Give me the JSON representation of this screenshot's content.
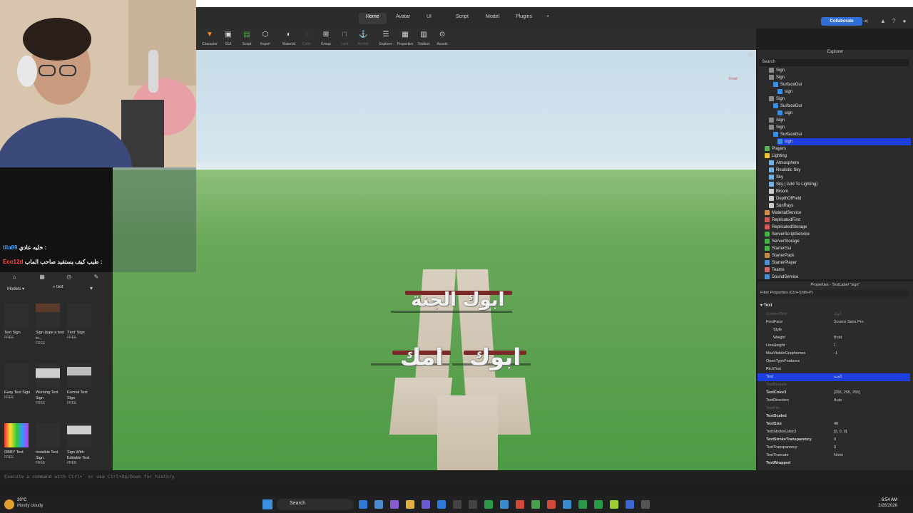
{
  "menubar": {
    "tabs": [
      "Home",
      "Avatar",
      "UI",
      "Script",
      "Model",
      "Plugins",
      "+"
    ],
    "active_tab": "Home",
    "collaborate_label": "Collaborate"
  },
  "toolbar": {
    "tools": [
      {
        "label": "Character",
        "icon": "character-icon"
      },
      {
        "label": "GUI",
        "icon": "gui-icon"
      },
      {
        "label": "Script",
        "icon": "script-icon"
      },
      {
        "label": "Import",
        "icon": "import-icon"
      },
      {
        "label": "Material",
        "icon": "material-icon"
      },
      {
        "label": "Color",
        "icon": "color-icon"
      },
      {
        "label": "Group",
        "icon": "group-icon"
      },
      {
        "label": "Lock",
        "icon": "lock-icon"
      },
      {
        "label": "Anchor",
        "icon": "anchor-icon"
      },
      {
        "label": "Explorer",
        "icon": "explorer-icon"
      },
      {
        "label": "Properties",
        "icon": "properties-icon"
      },
      {
        "label": "Toolbox",
        "icon": "toolbox-icon"
      },
      {
        "label": "Assets",
        "icon": "assets-icon"
      }
    ]
  },
  "viewport": {
    "viewcube_label": "Front",
    "signs": [
      "الجنة",
      "ابوك",
      "امك",
      "ابوك"
    ]
  },
  "chat": {
    "messages": [
      {
        "user": "tila89",
        "text": "خليه عادي :"
      },
      {
        "user": "Eco12d",
        "text": "طيب كيف يستفيد صاحب الماب :"
      }
    ]
  },
  "toolbox": {
    "category": "Models",
    "search_value": "text",
    "assets": [
      {
        "name": "Text Sign",
        "price": "FREE"
      },
      {
        "name": "Sign (type a text in...",
        "price": "FREE"
      },
      {
        "name": "'Text' Sign",
        "price": "FREE"
      },
      {
        "name": "Easy Text Sign",
        "price": "FREE"
      },
      {
        "name": "Working Text Sign",
        "price": "FREE"
      },
      {
        "name": "Formal Text Sign",
        "price": "FREE"
      },
      {
        "name": "OBBY Text",
        "price": "FREE"
      },
      {
        "name": "Invisible Text Sign",
        "price": "FREE"
      },
      {
        "name": "Sign With Editable Text",
        "price": "FREE"
      }
    ]
  },
  "explorer": {
    "title": "Explorer",
    "search_placeholder": "Search",
    "items": [
      {
        "label": "Sign",
        "indent": 1,
        "color": "#8a8a8a"
      },
      {
        "label": "Sign",
        "indent": 1,
        "color": "#8a8a8a"
      },
      {
        "label": "SurfaceGui",
        "indent": 2,
        "color": "#3a8fe0"
      },
      {
        "label": "sign",
        "indent": 3,
        "color": "#3a8fe0"
      },
      {
        "label": "Sign",
        "indent": 1,
        "color": "#8a8a8a"
      },
      {
        "label": "SurfaceGui",
        "indent": 2,
        "color": "#3a8fe0"
      },
      {
        "label": "sign",
        "indent": 3,
        "color": "#3a8fe0"
      },
      {
        "label": "Sign",
        "indent": 1,
        "color": "#8a8a8a"
      },
      {
        "label": "Sign",
        "indent": 1,
        "color": "#8a8a8a"
      },
      {
        "label": "SurfaceGui",
        "indent": 2,
        "color": "#3a8fe0"
      },
      {
        "label": "sign",
        "indent": 3,
        "color": "#3a8fe0",
        "selected": true
      },
      {
        "label": "Players",
        "indent": 0,
        "color": "#5ab55a"
      },
      {
        "label": "Lighting",
        "indent": 0,
        "color": "#e8c33a"
      },
      {
        "label": "Atmosphere",
        "indent": 1,
        "color": "#7ab0e0"
      },
      {
        "label": "Realistic Sky",
        "indent": 1,
        "color": "#7ab0e0"
      },
      {
        "label": "Sky",
        "indent": 1,
        "color": "#7ab0e0"
      },
      {
        "label": "Sky ( Add To Lighting)",
        "indent": 1,
        "color": "#7ab0e0"
      },
      {
        "label": "Bloom",
        "indent": 1,
        "color": "#c9c9c9"
      },
      {
        "label": "DepthOfField",
        "indent": 1,
        "color": "#c9c9c9"
      },
      {
        "label": "SunRays",
        "indent": 1,
        "color": "#c9c9c9"
      },
      {
        "label": "MaterialService",
        "indent": 0,
        "color": "#d08a4a"
      },
      {
        "label": "ReplicatedFirst",
        "indent": 0,
        "color": "#d05a5a"
      },
      {
        "label": "ReplicatedStorage",
        "indent": 0,
        "color": "#d05a5a"
      },
      {
        "label": "ServerScriptService",
        "indent": 0,
        "color": "#4ab04a"
      },
      {
        "label": "ServerStorage",
        "indent": 0,
        "color": "#4ab04a"
      },
      {
        "label": "StarterGui",
        "indent": 0,
        "color": "#4ab04a"
      },
      {
        "label": "StarterPack",
        "indent": 0,
        "color": "#c08a4a"
      },
      {
        "label": "StarterPlayer",
        "indent": 0,
        "color": "#4a90d0"
      },
      {
        "label": "Teams",
        "indent": 0,
        "color": "#d06a6a"
      },
      {
        "label": "SoundService",
        "indent": 0,
        "color": "#4a90d0"
      }
    ]
  },
  "properties": {
    "title": "Properties - TextLabel \"sign\"",
    "filter_placeholder": "Filter Properties (Ctrl+Shift+P)",
    "section": "Text",
    "rows": [
      {
        "name": "ContentText",
        "value": "ابوك",
        "style": "dim"
      },
      {
        "name": "FontFace",
        "value": "Source Sans Pro",
        "style": ""
      },
      {
        "name": "Style",
        "value": "",
        "style": "sub"
      },
      {
        "name": "Weight",
        "value": "Bold",
        "style": "sub"
      },
      {
        "name": "LineHeight",
        "value": "1",
        "style": ""
      },
      {
        "name": "MaxVisibleGraphemes",
        "value": "-1",
        "style": ""
      },
      {
        "name": "OpenTypeFeatures",
        "value": "",
        "style": ""
      },
      {
        "name": "RichText",
        "value": "",
        "style": ""
      },
      {
        "name": "Text",
        "value": "الجنة",
        "style": "sel"
      },
      {
        "name": "TextBounds",
        "value": "",
        "style": "dim"
      },
      {
        "name": "TextColor3",
        "value": "[255, 255, 255]",
        "style": "bold"
      },
      {
        "name": "TextDirection",
        "value": "Auto",
        "style": ""
      },
      {
        "name": "TextFits",
        "value": "",
        "style": "dim"
      },
      {
        "name": "TextScaled",
        "value": "",
        "style": "bold"
      },
      {
        "name": "TextSize",
        "value": "48",
        "style": "bold"
      },
      {
        "name": "TextStrokeColor3",
        "value": "[0, 0, 0]",
        "style": ""
      },
      {
        "name": "TextStrokeTransparency",
        "value": "0",
        "style": "bold"
      },
      {
        "name": "TextTransparency",
        "value": "0",
        "style": ""
      },
      {
        "name": "TextTruncate",
        "value": "None",
        "style": ""
      },
      {
        "name": "TextWrapped",
        "value": "",
        "style": "bold"
      }
    ]
  },
  "cmdbar": {
    "placeholder": "Execute a command with Ctrl+` or use Ctrl+Up/Down for history"
  },
  "taskbar": {
    "weather_temp": "20°C",
    "weather_desc": "Mostly cloudy",
    "search_label": "Search",
    "time": "6:54 AM",
    "date": "3/26/2026"
  },
  "colors": {
    "accent": "#1d3fe0",
    "collaborate": "#2f6fd6",
    "sign_bar": "#7b2a28"
  }
}
